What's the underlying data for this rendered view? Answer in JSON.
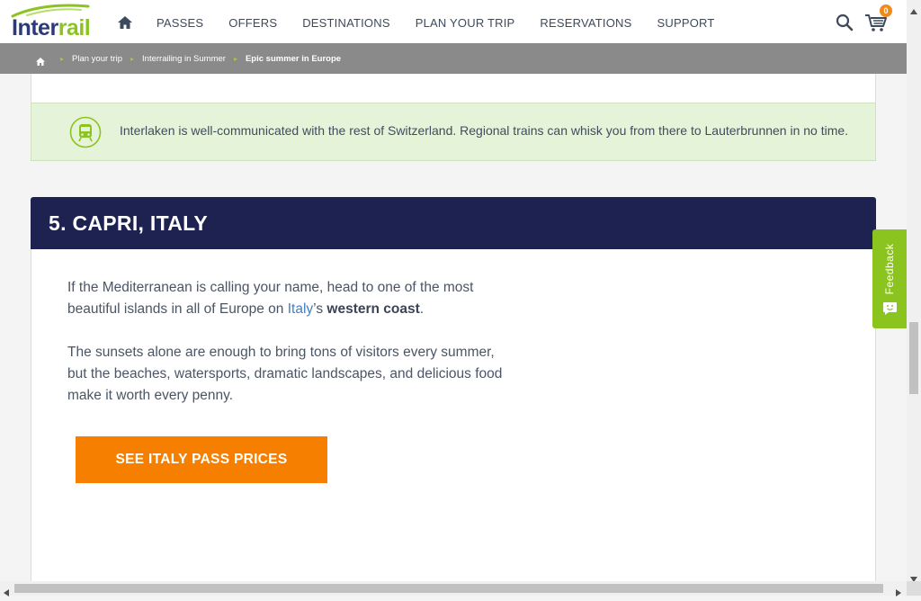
{
  "header": {
    "logo": {
      "part1": "Inter",
      "part2": "rail"
    },
    "nav": [
      "PASSES",
      "OFFERS",
      "DESTINATIONS",
      "PLAN YOUR TRIP",
      "RESERVATIONS",
      "SUPPORT"
    ],
    "cart_count": "0"
  },
  "breadcrumb": {
    "items": [
      "Plan your trip",
      "Interrailing in Summer"
    ],
    "current": "Epic summer in Europe",
    "separator": "▸"
  },
  "tip": {
    "text": "Interlaken is well-communicated with the rest of Switzerland. Regional trains can whisk you from there to Lauterbrunnen in no time."
  },
  "section": {
    "title": "5. CAPRI, ITALY",
    "para1_before": "If the Mediterranean is calling your name, head to one of the most beautiful islands in all of Europe on ",
    "para1_link": "Italy",
    "para1_mid": "’s ",
    "para1_bold": "western coast",
    "para1_end": ".",
    "para2": "The sunsets alone are enough to bring tons of visitors every summer, but the beaches, watersports, dramatic landscapes, and delicious food make it worth every penny.",
    "cta": "SEE ITALY PASS PRICES"
  },
  "feedback": {
    "label": "Feedback"
  },
  "colors": {
    "navy": "#1d2250",
    "orange": "#f77f00",
    "green": "#8bc31f",
    "tip_bg": "#e5f3d9",
    "link": "#3f7fc8"
  },
  "icons": [
    "home-icon",
    "search-icon",
    "cart-icon",
    "train-icon",
    "feedback-smile-icon"
  ]
}
